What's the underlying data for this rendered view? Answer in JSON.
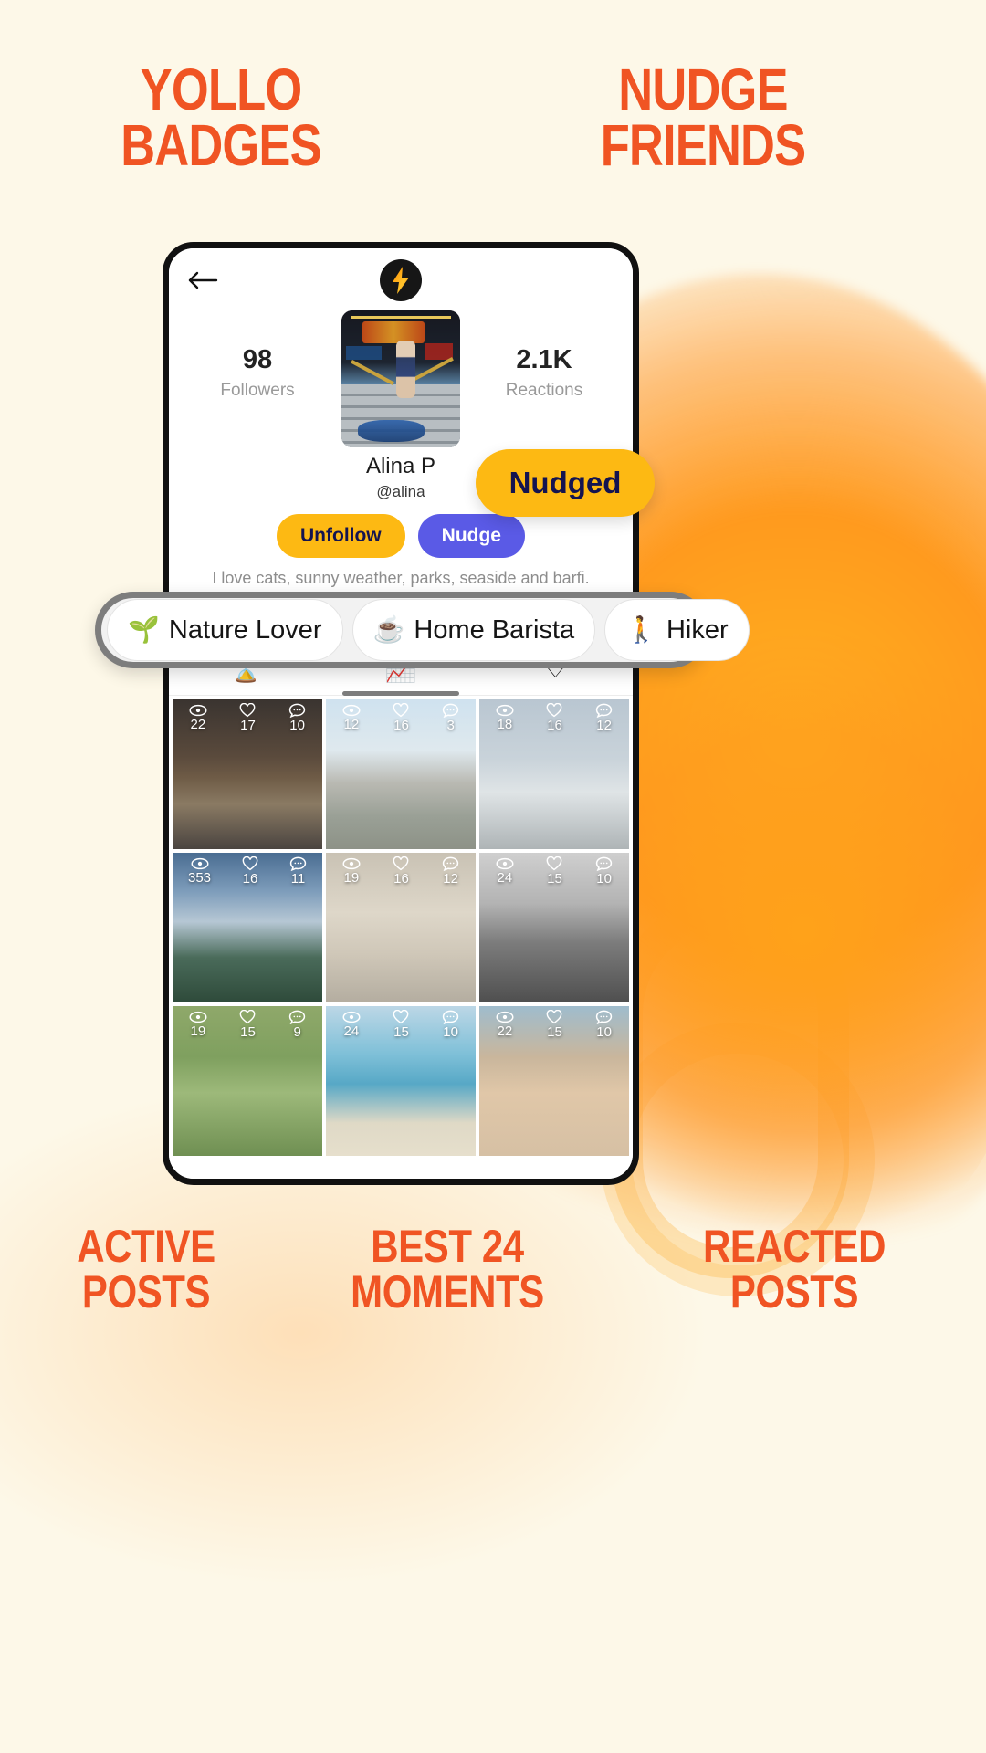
{
  "theme": {
    "bg": "#fdf8e8",
    "accent_orange": "#f05423",
    "amber": "#fdb913",
    "indigo": "#5a5ae6",
    "navy_text": "#141450"
  },
  "headlines": {
    "top_left_line1": "YOLLO",
    "top_left_line2": "BADGES",
    "top_right_line1": "NUDGE",
    "top_right_line2": "FRIENDS",
    "bottom_left_line1": "ACTIVE",
    "bottom_left_line2": "POSTS",
    "bottom_center_line1": "BEST 24",
    "bottom_center_line2": "MOMENTS",
    "bottom_right_line1": "REACTED",
    "bottom_right_line2": "POSTS"
  },
  "callouts": {
    "nudged_pill": "Nudged"
  },
  "phone": {
    "topbar": {
      "back_icon": "back-arrow-icon",
      "logo_icon": "lightning-bolt-logo"
    },
    "profile": {
      "followers_count": "98",
      "followers_label": "Followers",
      "reactions_count": "2.1K",
      "reactions_label": "Reactions",
      "avatar_icon": "profile-avatar",
      "name": "Alina P",
      "handle": "@alina",
      "bio": "I love cats, sunny weather, parks, seaside and barfi.",
      "unfollow_label": "Unfollow",
      "nudge_label": "Nudge"
    },
    "badges": [
      {
        "label": "Nature Lover",
        "icon": "flower-icon",
        "glyph": "🌱"
      },
      {
        "label": "Home Barista",
        "icon": "coffee-cup-icon",
        "glyph": "☕"
      },
      {
        "label": "Hiker",
        "icon": "hiker-icon",
        "glyph": "🚶"
      }
    ],
    "tabs": [
      {
        "id": "recent",
        "icon": "hourglass-icon",
        "glyph": "⌛",
        "active": false
      },
      {
        "id": "active",
        "icon": "trending-chart-icon",
        "glyph": "📈",
        "active": true
      },
      {
        "id": "reacted",
        "icon": "heart-outline-icon",
        "glyph": "♡",
        "active": false
      }
    ],
    "grid": [
      {
        "views": "22",
        "likes": "17",
        "comments": "10",
        "scene": "pub-street"
      },
      {
        "views": "12",
        "likes": "16",
        "comments": "3",
        "scene": "city-rainbow"
      },
      {
        "views": "18",
        "likes": "16",
        "comments": "12",
        "scene": "winter-building"
      },
      {
        "views": "353",
        "likes": "16",
        "comments": "11",
        "scene": "sunset-water"
      },
      {
        "views": "19",
        "likes": "16",
        "comments": "12",
        "scene": "columns-portrait"
      },
      {
        "views": "24",
        "likes": "15",
        "comments": "10",
        "scene": "spiral-staircase"
      },
      {
        "views": "19",
        "likes": "15",
        "comments": "9",
        "scene": "park-bench"
      },
      {
        "views": "24",
        "likes": "15",
        "comments": "10",
        "scene": "beach-sea"
      },
      {
        "views": "22",
        "likes": "15",
        "comments": "10",
        "scene": "selfie-sunglasses"
      }
    ],
    "stat_icons": {
      "views": "eye-icon",
      "likes": "heart-icon",
      "comments": "comment-icon"
    }
  }
}
